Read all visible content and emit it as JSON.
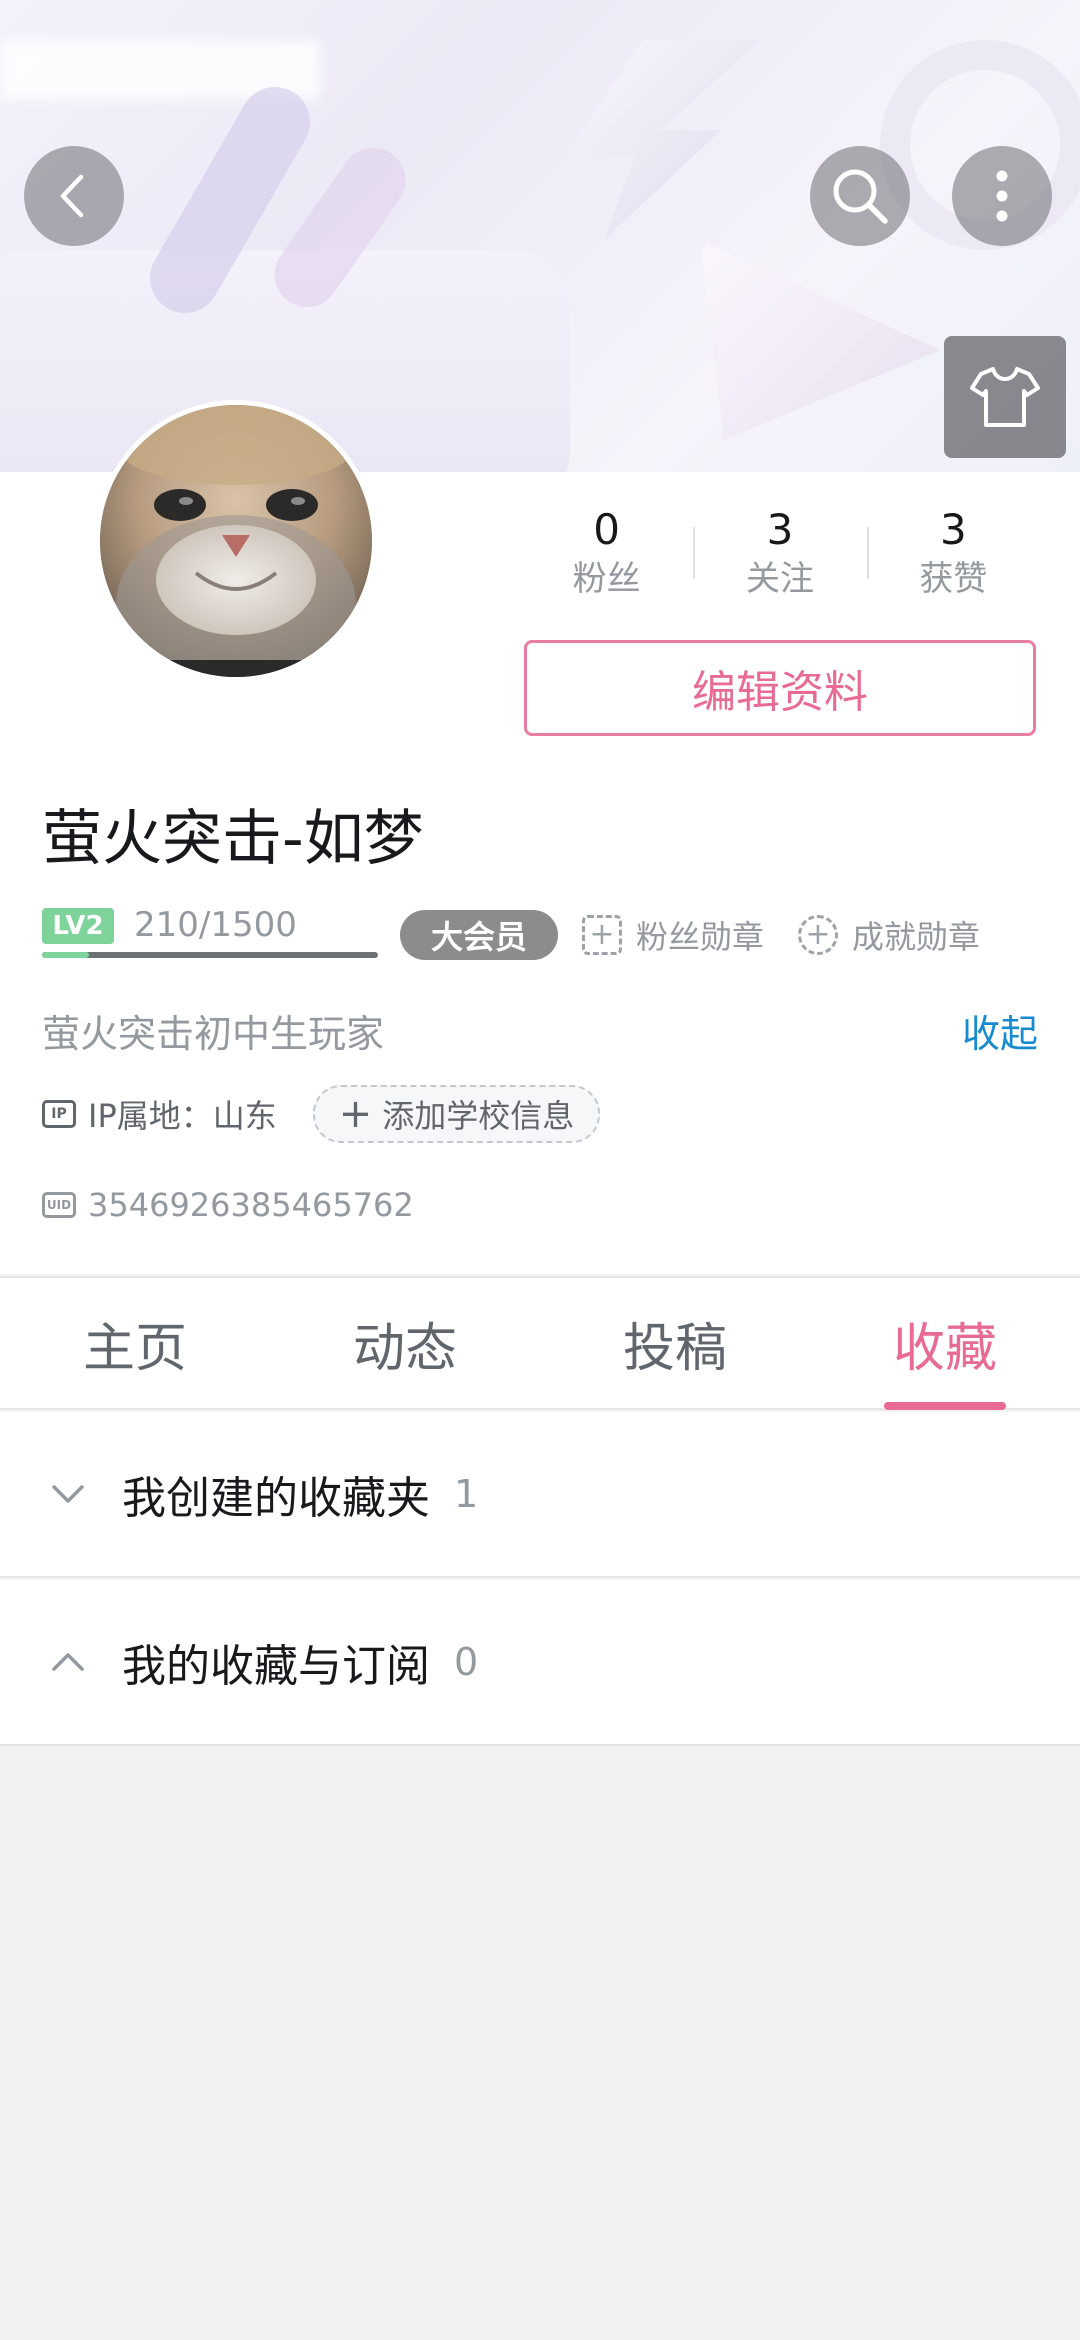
{
  "header": {
    "back_icon": "chevron-left-icon",
    "search_icon": "search-icon",
    "more_icon": "more-vertical-icon",
    "dress_icon": "tshirt-icon"
  },
  "profile": {
    "avatar": "cat-avatar",
    "stats": [
      {
        "value": "0",
        "label": "粉丝"
      },
      {
        "value": "3",
        "label": "关注"
      },
      {
        "value": "3",
        "label": "获赞"
      }
    ],
    "edit_label": "编辑资料",
    "username": "萤火突击-如梦",
    "level_badge": "LV2",
    "exp": "210/1500",
    "exp_fraction": 0.14,
    "vip_label": "大会员",
    "fans_medal": "粉丝勋章",
    "achievement_medal": "成就勋章",
    "bio": "萤火突击初中生玩家",
    "collapse_label": "收起",
    "ip_icon_text": "IP",
    "ip_location": "IP属地：山东",
    "add_school_label": "添加学校信息",
    "uid_icon_text": "UID",
    "uid": "3546926385465762"
  },
  "tabs": [
    {
      "label": "主页",
      "active": false
    },
    {
      "label": "动态",
      "active": false
    },
    {
      "label": "投稿",
      "active": false
    },
    {
      "label": "收藏",
      "active": true
    }
  ],
  "favorites": {
    "created": {
      "title": "我创建的收藏夹",
      "count": "1",
      "expanded": false
    },
    "subscribed": {
      "title": "我的收藏与订阅",
      "count": "0",
      "expanded": true
    }
  },
  "colors": {
    "accent_pink": "#e86b93",
    "link_blue": "#178bcf",
    "level_green": "#7dd39a",
    "page_bg": "#f0f2f4"
  }
}
